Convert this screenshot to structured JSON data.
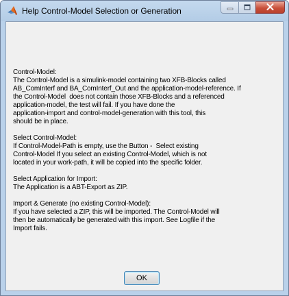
{
  "window": {
    "title": "Help Control-Model Selection or Generation",
    "icon": "matlab-logo-icon",
    "controls": {
      "minimize_icon": "minimize-icon",
      "maximize_icon": "maximize-icon",
      "close_icon": "close-icon"
    }
  },
  "help_text": "Control-Model:\nThe Control-Model is a simulink-model containing two XFB-Blocks called\nAB_ComInterf and BA_ComInterf_Out and the application-model-reference. If\nthe Control-Model  does not contain those XFB-Blocks and a referenced\napplication-model, the test will fail. If you have done the\napplication-import and control-model-generation with this tool, this\nshould be in place.\n\nSelect Control-Model:\nIf Control-Model-Path is empty, use the Button -  Select existing\nControl-Model If you select an existing Control-Model, which is not\nlocated in your work-path, it will be copied into the specific folder.\n\nSelect Application for Import:\nThe Application is a ABT-Export as ZIP.\n\nImport & Generate (no existing Control-Model):\nIf you have selected a ZIP, this will be imported. The Control-Model will\nthen be automatically be generated with this import. See Logfile if the\nImport fails.",
  "buttons": {
    "ok": "OK"
  },
  "colors": {
    "title_bar": "#b9d1ea",
    "client_background": "#f0f0f0",
    "close_button": "#c9503a"
  }
}
